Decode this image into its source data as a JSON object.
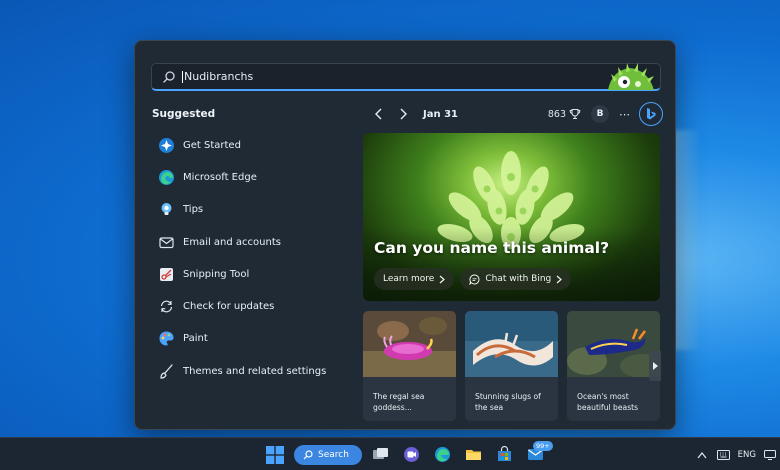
{
  "search": {
    "query": "Nudibranchs"
  },
  "suggested": {
    "title": "Suggested",
    "items": [
      {
        "label": "Get Started",
        "icon": "get-started-icon"
      },
      {
        "label": "Microsoft Edge",
        "icon": "edge-icon"
      },
      {
        "label": "Tips",
        "icon": "tips-icon"
      },
      {
        "label": "Email and accounts",
        "icon": "mail-icon"
      },
      {
        "label": "Snipping Tool",
        "icon": "snipping-tool-icon"
      },
      {
        "label": "Check for updates",
        "icon": "refresh-icon"
      },
      {
        "label": "Paint",
        "icon": "paint-icon"
      },
      {
        "label": "Themes and related settings",
        "icon": "brush-icon"
      }
    ]
  },
  "nav": {
    "date": "Jan 31",
    "points": "863",
    "avatar_initial": "B"
  },
  "hero": {
    "title": "Can you name this animal?",
    "learn_more": "Learn more",
    "chat_with_bing": "Chat with Bing"
  },
  "cards": [
    {
      "line1": "The regal sea",
      "line2": "goddess..."
    },
    {
      "line1": "Stunning slugs of",
      "line2": "the sea"
    },
    {
      "line1": "Ocean's most",
      "line2": "beautiful beasts"
    }
  ],
  "taskbar": {
    "search_label": "Search",
    "badge": "99+",
    "language": "ENG"
  },
  "colors": {
    "accent": "#4aa3ff",
    "panel_bg": "#202a35",
    "card_bg": "#2b3541",
    "taskbar_bg": "#1c2633"
  }
}
